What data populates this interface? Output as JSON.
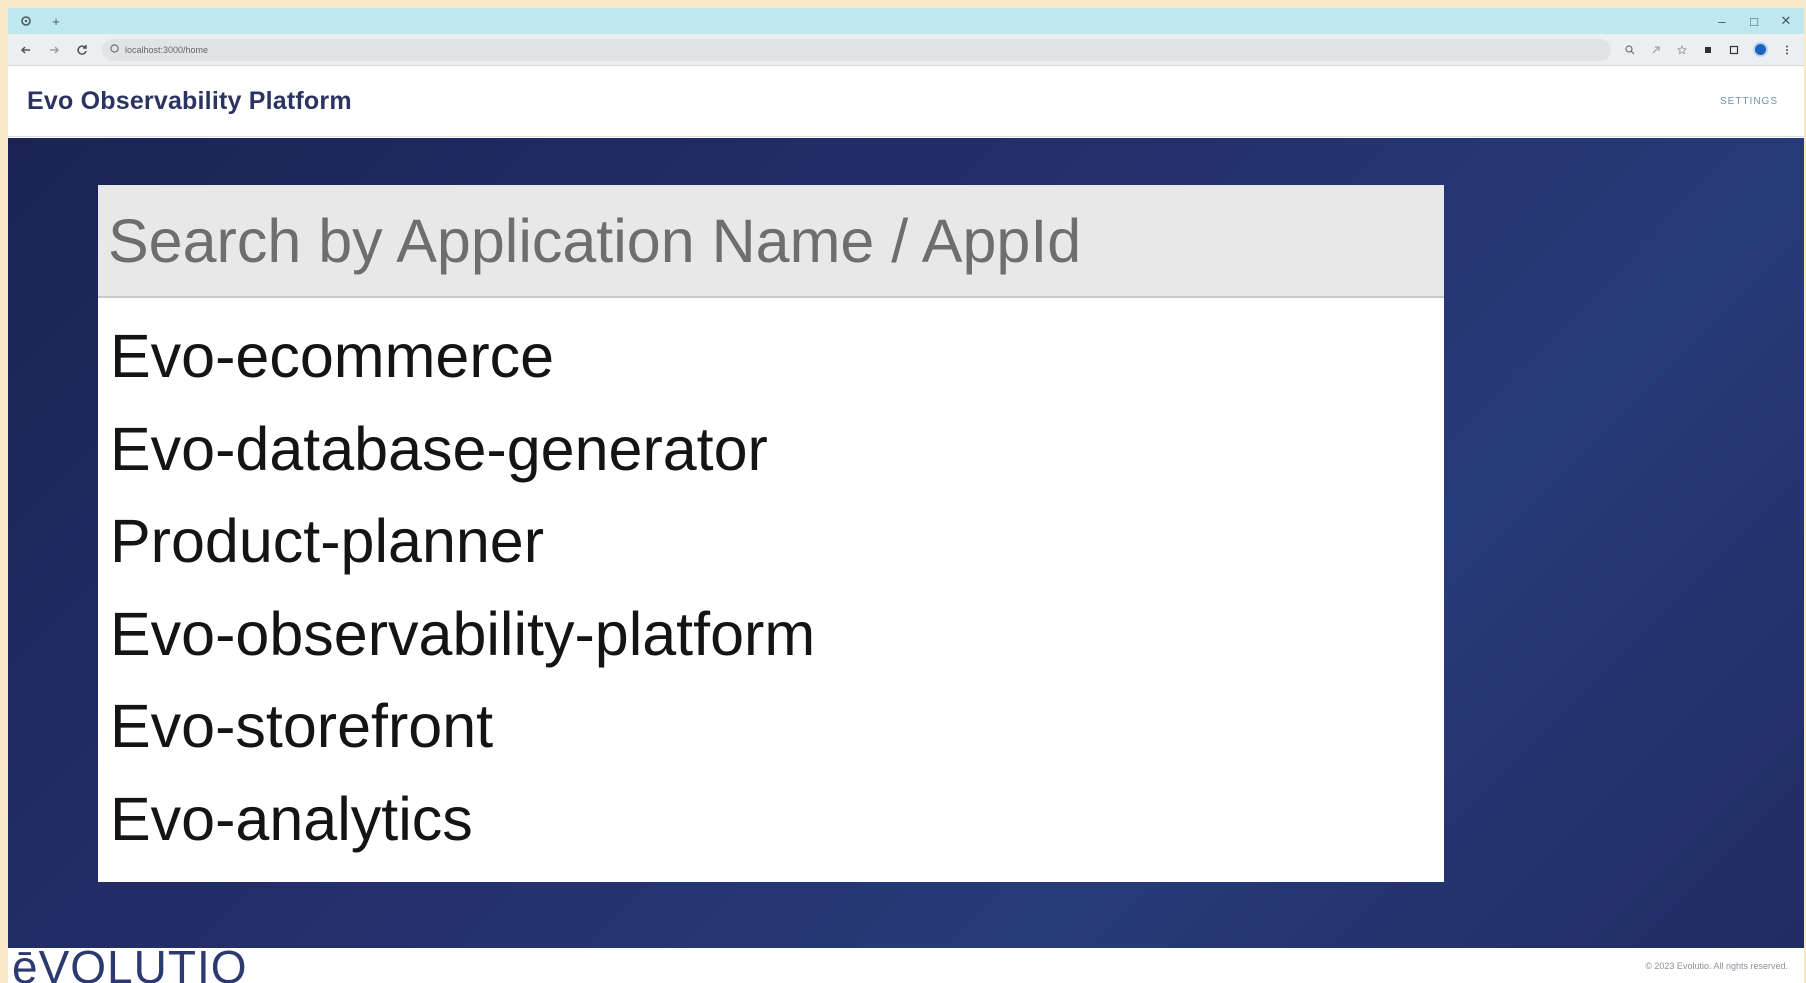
{
  "browser": {
    "tab_icon": "settings-icon",
    "new_tab_label": "+",
    "url": "localhost:3000/home",
    "window_controls": [
      "–",
      "□",
      "✕"
    ]
  },
  "header": {
    "title": "Evo Observability Platform",
    "settings_label": "SETTINGS"
  },
  "search": {
    "placeholder": "Search by Application Name / AppId",
    "value": ""
  },
  "applications": [
    "Evo-ecommerce",
    "Evo-database-generator",
    "Product-planner",
    "Evo-observability-platform",
    "Evo-storefront",
    "Evo-analytics"
  ],
  "footer": {
    "brand": "ēVOLUTIO",
    "copyright": "© 2023 Evolutio. All rights reserved."
  },
  "colors": {
    "accent": "#2b3461",
    "hero_bg": "#232d66",
    "tab_strip": "#bfe7ee"
  }
}
